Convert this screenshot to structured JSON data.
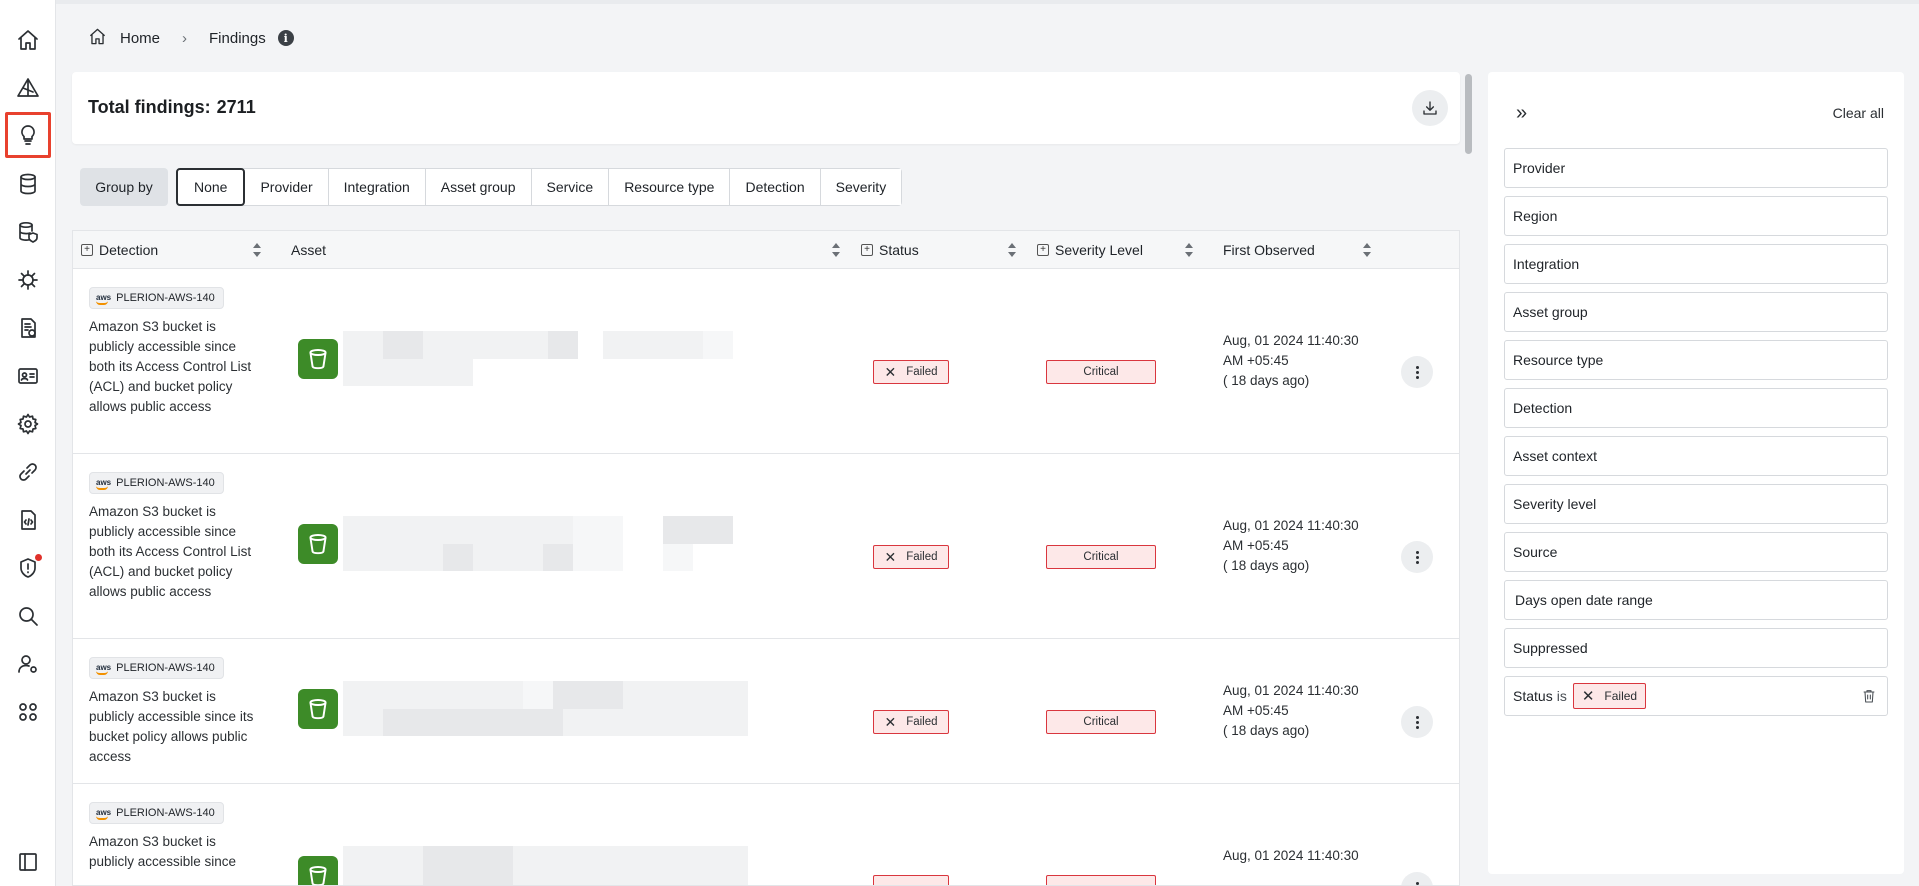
{
  "breadcrumb": {
    "home": "Home",
    "current": "Findings"
  },
  "header": {
    "total_label": "Total findings:",
    "total_count": "2711"
  },
  "group_by": {
    "label": "Group by",
    "options": [
      "None",
      "Provider",
      "Integration",
      "Asset group",
      "Service",
      "Resource type",
      "Detection",
      "Severity"
    ],
    "selected": "None"
  },
  "table": {
    "columns": [
      "Detection",
      "Asset",
      "Status",
      "Severity Level",
      "First Observed"
    ],
    "rows": [
      {
        "provider": "aws",
        "id": "PLERION-AWS-140",
        "description": "Amazon S3 bucket is publicly accessible since both its Access Control List (ACL) and bucket policy allows public access",
        "status": "Failed",
        "severity": "Critical",
        "observed": "Aug, 01 2024 11:40:30 AM +05:45",
        "age": "( 18 days ago)"
      },
      {
        "provider": "aws",
        "id": "PLERION-AWS-140",
        "description": "Amazon S3 bucket is publicly accessible since both its Access Control List (ACL) and bucket policy allows public access",
        "status": "Failed",
        "severity": "Critical",
        "observed": "Aug, 01 2024 11:40:30 AM +05:45",
        "age": "( 18 days ago)"
      },
      {
        "provider": "aws",
        "id": "PLERION-AWS-140",
        "description": "Amazon S3 bucket is publicly accessible since its bucket policy allows public access",
        "status": "Failed",
        "severity": "Critical",
        "observed": "Aug, 01 2024 11:40:30 AM +05:45",
        "age": "( 18 days ago)"
      },
      {
        "provider": "aws",
        "id": "PLERION-AWS-140",
        "description": "Amazon S3 bucket is publicly accessible since",
        "status": "",
        "severity": "",
        "observed": "Aug, 01 2024 11:40:30",
        "age": ""
      }
    ]
  },
  "filters": {
    "clear_all": "Clear all",
    "items": [
      "Provider",
      "Region",
      "Integration",
      "Asset group",
      "Resource type",
      "Detection",
      "Asset context",
      "Severity level",
      "Source",
      "Days open date range",
      "Suppressed"
    ],
    "active": {
      "field": "Status",
      "operator": "is",
      "value": "Failed"
    }
  },
  "colors": {
    "accent_red": "#d9363e",
    "bucket_green": "#3d8b28",
    "active_outline": "#e8412e"
  },
  "icons": {
    "rail": [
      "home-icon",
      "alert-triangle-icon",
      "lightbulb-icon",
      "database-icon",
      "database-shield-icon",
      "bug-icon",
      "report-icon",
      "id-card-icon",
      "gear-icon",
      "link-icon",
      "code-file-icon",
      "shield-icon",
      "search-icon",
      "user-cog-icon",
      "apps-icon",
      "sidebar-toggle-icon"
    ]
  }
}
